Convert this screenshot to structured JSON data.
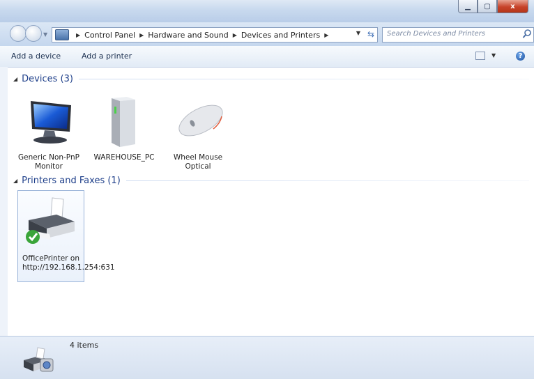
{
  "window": {
    "controls": [
      "minimize",
      "maximize",
      "close"
    ],
    "close_symbol": "x"
  },
  "navigation": {
    "breadcrumbs": [
      "Control Panel",
      "Hardware and Sound",
      "Devices and Printers"
    ],
    "search_placeholder": "Search Devices and Printers"
  },
  "toolbar": {
    "add_device": "Add a device",
    "add_printer": "Add a printer",
    "help_symbol": "?"
  },
  "groups": {
    "devices": {
      "title": "Devices (3)",
      "items": [
        {
          "name": "Generic Non-PnP Monitor",
          "icon": "monitor-icon"
        },
        {
          "name": "WAREHOUSE_PC",
          "icon": "computer-tower-icon"
        },
        {
          "name": "Wheel Mouse Optical",
          "icon": "mouse-icon"
        }
      ]
    },
    "printers": {
      "title": "Printers and Faxes (1)",
      "items": [
        {
          "name": "OfficePrinter on http://192.168.1.254:631",
          "icon": "printer-icon",
          "default": true
        }
      ]
    }
  },
  "status": {
    "count_text": "4 items"
  }
}
